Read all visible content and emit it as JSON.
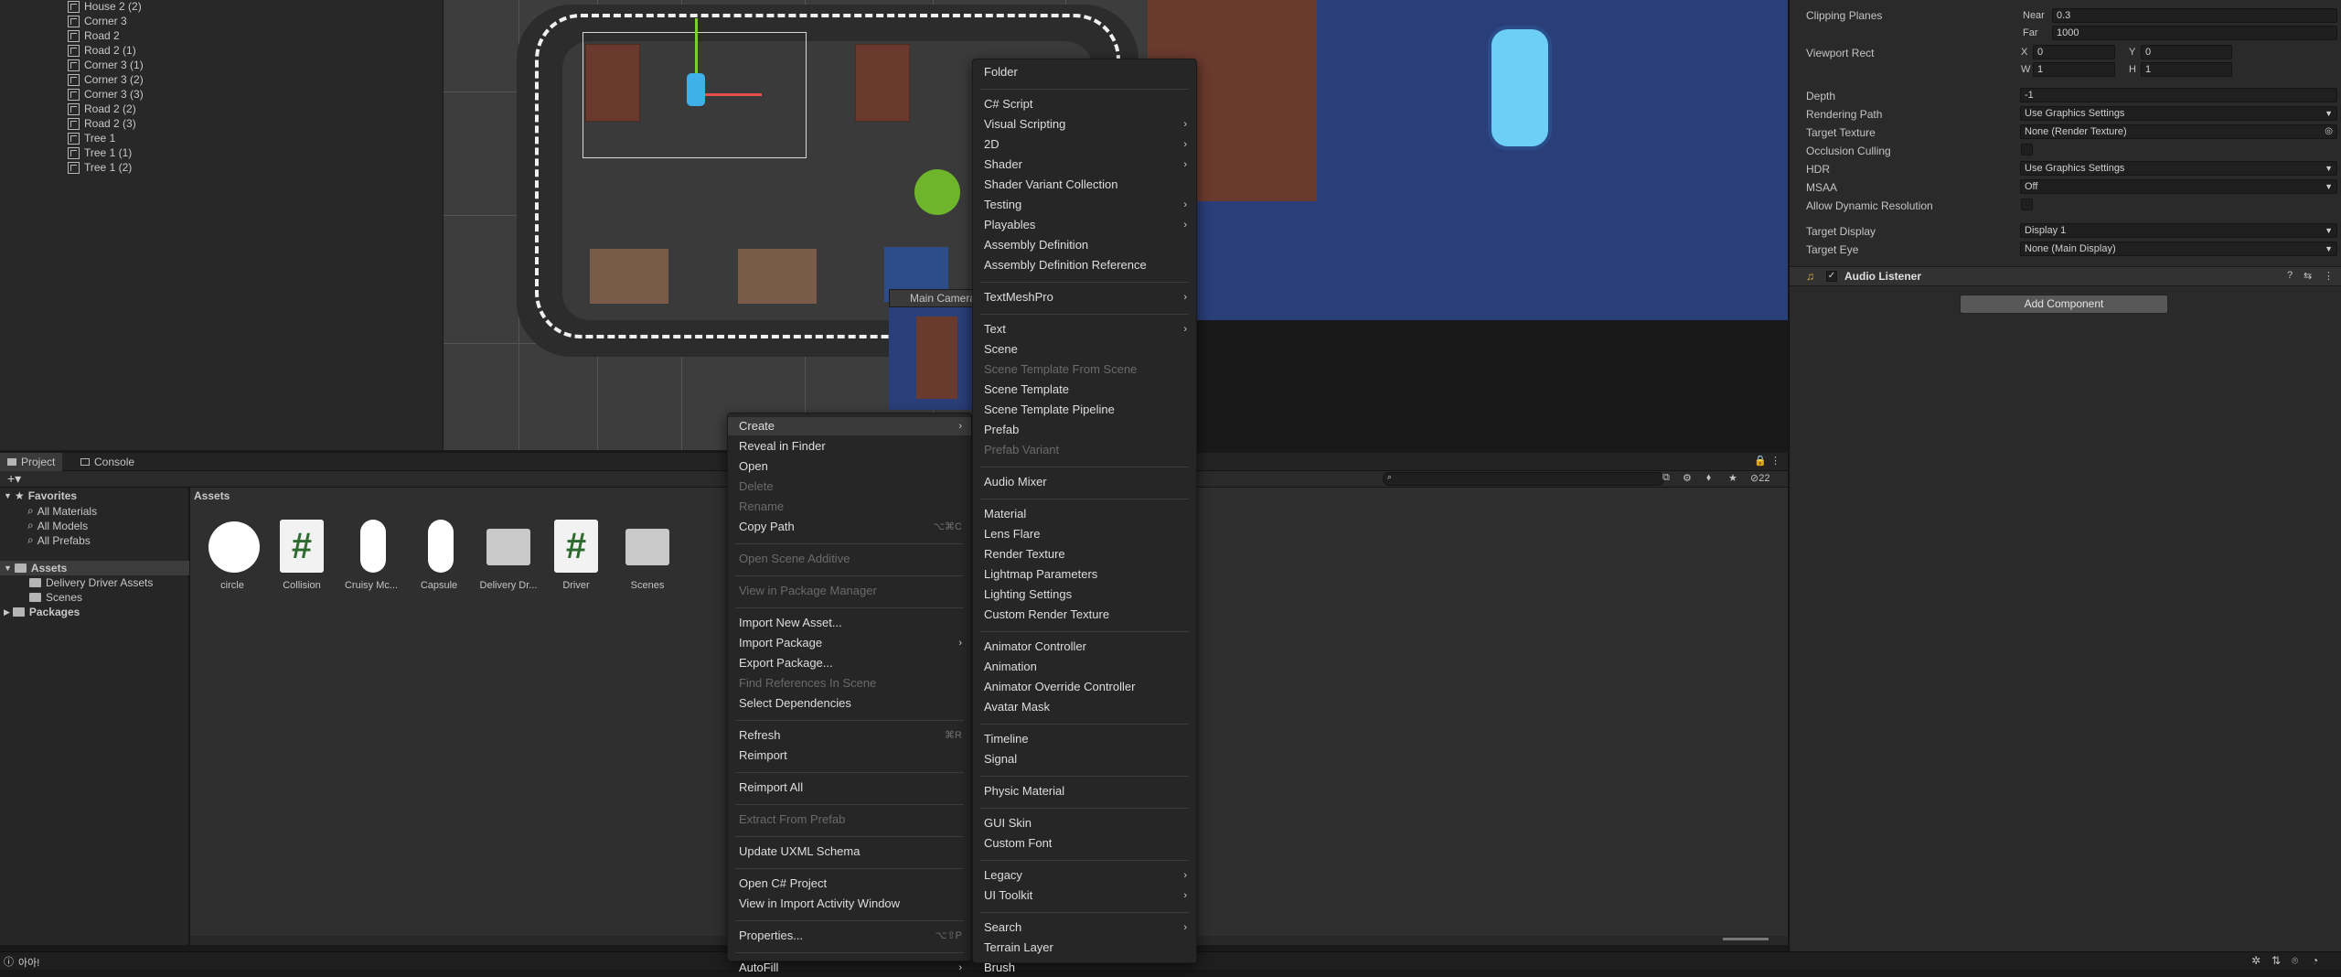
{
  "hierarchy": {
    "items": [
      "House 2 (2)",
      "Corner 3",
      "Road 2",
      "Road 2 (1)",
      "Corner 3 (1)",
      "Corner 3 (2)",
      "Corner 3 (3)",
      "Road 2 (2)",
      "Road 2 (3)",
      "Tree 1",
      "Tree 1 (1)",
      "Tree 1 (2)"
    ]
  },
  "scene": {
    "camera_label": "Main Camera"
  },
  "inspector": {
    "clipping_planes_label": "Clipping Planes",
    "near_label": "Near",
    "near_value": "0.3",
    "far_label": "Far",
    "far_value": "1000",
    "viewport_rect_label": "Viewport Rect",
    "x_label": "X",
    "x_value": "0",
    "y_label": "Y",
    "y_value": "0",
    "w_label": "W",
    "w_value": "1",
    "h_label": "H",
    "h_value": "1",
    "depth_label": "Depth",
    "depth_value": "-1",
    "rendering_path_label": "Rendering Path",
    "rendering_path_value": "Use Graphics Settings",
    "target_texture_label": "Target Texture",
    "target_texture_value": "None (Render Texture)",
    "occlusion_culling_label": "Occlusion Culling",
    "hdr_label": "HDR",
    "hdr_value": "Use Graphics Settings",
    "msaa_label": "MSAA",
    "msaa_value": "Off",
    "dynamic_res_label": "Allow Dynamic Resolution",
    "target_display_label": "Target Display",
    "target_display_value": "Display 1",
    "target_eye_label": "Target Eye",
    "target_eye_value": "None (Main Display)",
    "audio_listener_label": "Audio Listener",
    "add_component_label": "Add Component"
  },
  "project": {
    "tabs": [
      "Project",
      "Console"
    ],
    "favorites_label": "Favorites",
    "favorites": [
      "All Materials",
      "All Models",
      "All Prefabs"
    ],
    "assets_label": "Assets",
    "asset_folders": [
      "Delivery Driver Assets",
      "Scenes"
    ],
    "packages_label": "Packages",
    "breadcrumb": "Assets",
    "hidden_count": "22",
    "asset_items": [
      {
        "name": "circle",
        "kind": "circle"
      },
      {
        "name": "Collision",
        "kind": "script"
      },
      {
        "name": "Cruisy Mc...",
        "kind": "capsule"
      },
      {
        "name": "Capsule",
        "kind": "capsule"
      },
      {
        "name": "Delivery Dr...",
        "kind": "folder"
      },
      {
        "name": "Driver",
        "kind": "script"
      },
      {
        "name": "Scenes",
        "kind": "folder"
      }
    ]
  },
  "status": {
    "text": "아아!"
  },
  "context_menu": {
    "items": [
      {
        "label": "Create",
        "arrow": true,
        "highlight": true
      },
      {
        "label": "Reveal in Finder"
      },
      {
        "label": "Open"
      },
      {
        "label": "Delete",
        "disabled": true
      },
      {
        "label": "Rename",
        "disabled": true
      },
      {
        "label": "Copy Path",
        "shortcut": "⌥⌘C"
      },
      {
        "sep": true
      },
      {
        "label": "Open Scene Additive",
        "disabled": true
      },
      {
        "sep": true
      },
      {
        "label": "View in Package Manager",
        "disabled": true
      },
      {
        "sep": true
      },
      {
        "label": "Import New Asset..."
      },
      {
        "label": "Import Package",
        "arrow": true
      },
      {
        "label": "Export Package..."
      },
      {
        "label": "Find References In Scene",
        "disabled": true
      },
      {
        "label": "Select Dependencies"
      },
      {
        "sep": true
      },
      {
        "label": "Refresh",
        "shortcut": "⌘R"
      },
      {
        "label": "Reimport"
      },
      {
        "sep": true
      },
      {
        "label": "Reimport All"
      },
      {
        "sep": true
      },
      {
        "label": "Extract From Prefab",
        "disabled": true
      },
      {
        "sep": true
      },
      {
        "label": "Update UXML Schema"
      },
      {
        "sep": true
      },
      {
        "label": "Open C# Project"
      },
      {
        "label": "View in Import Activity Window"
      },
      {
        "sep": true
      },
      {
        "label": "Properties...",
        "shortcut": "⌥⇧P"
      },
      {
        "sep": true
      },
      {
        "label": "AutoFill",
        "arrow": true
      }
    ]
  },
  "create_menu": {
    "items": [
      {
        "label": "Folder"
      },
      {
        "sep": true
      },
      {
        "label": "C# Script"
      },
      {
        "label": "Visual Scripting",
        "arrow": true
      },
      {
        "label": "2D",
        "arrow": true
      },
      {
        "label": "Shader",
        "arrow": true
      },
      {
        "label": "Shader Variant Collection"
      },
      {
        "label": "Testing",
        "arrow": true
      },
      {
        "label": "Playables",
        "arrow": true
      },
      {
        "label": "Assembly Definition"
      },
      {
        "label": "Assembly Definition Reference"
      },
      {
        "sep": true
      },
      {
        "label": "TextMeshPro",
        "arrow": true
      },
      {
        "sep": true
      },
      {
        "label": "Text",
        "arrow": true
      },
      {
        "label": "Scene"
      },
      {
        "label": "Scene Template From Scene",
        "disabled": true
      },
      {
        "label": "Scene Template"
      },
      {
        "label": "Scene Template Pipeline"
      },
      {
        "label": "Prefab"
      },
      {
        "label": "Prefab Variant",
        "disabled": true
      },
      {
        "sep": true
      },
      {
        "label": "Audio Mixer"
      },
      {
        "sep": true
      },
      {
        "label": "Material"
      },
      {
        "label": "Lens Flare"
      },
      {
        "label": "Render Texture"
      },
      {
        "label": "Lightmap Parameters"
      },
      {
        "label": "Lighting Settings"
      },
      {
        "label": "Custom Render Texture"
      },
      {
        "sep": true
      },
      {
        "label": "Animator Controller"
      },
      {
        "label": "Animation"
      },
      {
        "label": "Animator Override Controller"
      },
      {
        "label": "Avatar Mask"
      },
      {
        "sep": true
      },
      {
        "label": "Timeline"
      },
      {
        "label": "Signal"
      },
      {
        "sep": true
      },
      {
        "label": "Physic Material"
      },
      {
        "sep": true
      },
      {
        "label": "GUI Skin"
      },
      {
        "label": "Custom Font"
      },
      {
        "sep": true
      },
      {
        "label": "Legacy",
        "arrow": true
      },
      {
        "label": "UI Toolkit",
        "arrow": true
      },
      {
        "sep": true
      },
      {
        "label": "Search",
        "arrow": true
      },
      {
        "label": "Terrain Layer"
      },
      {
        "label": "Brush"
      }
    ]
  }
}
